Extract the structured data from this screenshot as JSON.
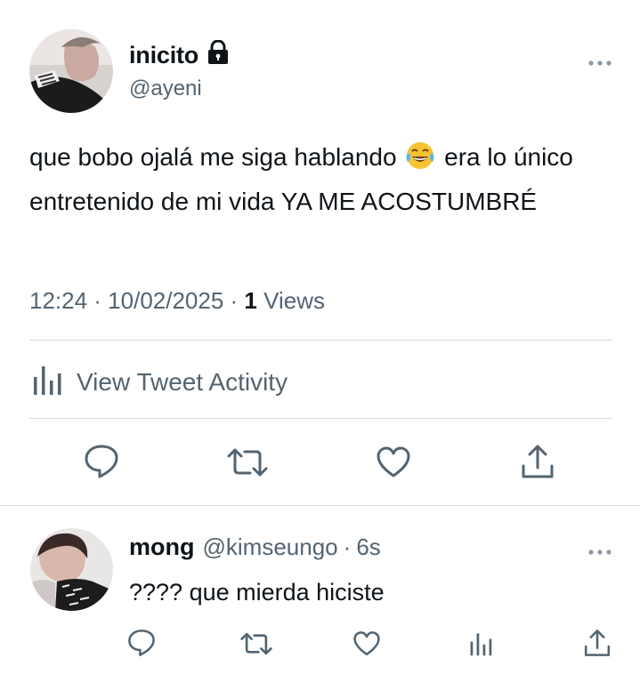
{
  "tweet": {
    "display_name": "inicito",
    "handle": "@ayeni",
    "text_part1": "que bobo ojalá me siga hablando",
    "text_part2": " era lo único entretenido de mi vida YA ME ACOSTUMBRÉ",
    "time": "12:24 · 10/02/2025 · ",
    "views_count": "1",
    "views_label": " Views",
    "activity_label": "View Tweet Activity"
  },
  "reply": {
    "display_name": "mong",
    "handle": "@kimseungo",
    "separator": "·",
    "time": "6s",
    "text": "???? que mierda hiciste"
  },
  "colors": {
    "text": "#0f1419",
    "secondary": "#536471",
    "divider": "#cfd9de"
  },
  "icons": {
    "lock": "lock-icon",
    "more": "more-icon",
    "reply": "reply-icon",
    "retweet": "retweet-icon",
    "like": "like-icon",
    "share": "share-icon",
    "analytics": "analytics-icon",
    "emoji": "tears-of-joy-emoji"
  }
}
